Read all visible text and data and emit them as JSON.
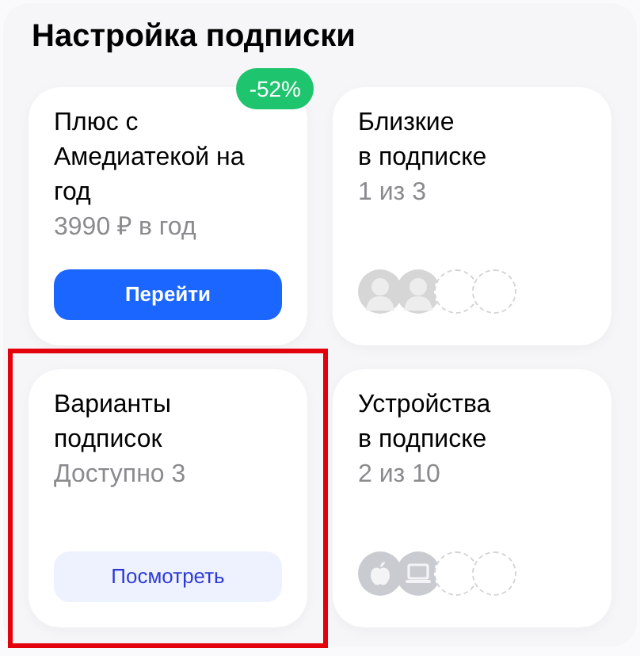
{
  "title": "Настройка подписки",
  "cards": [
    {
      "kind": "action",
      "title_lines": [
        "Плюс с",
        "Амедиатекой на",
        "год"
      ],
      "subtitle": "3990 ₽ в год",
      "badge": "-52%",
      "button": {
        "label": "Перейти",
        "kind": "primary"
      },
      "highlighted": false
    },
    {
      "kind": "slots",
      "title_lines": [
        "Близкие",
        "в подписке"
      ],
      "subtitle": "1 из 3",
      "slots": [
        {
          "kind": "person"
        },
        {
          "kind": "person"
        },
        {
          "kind": "empty"
        },
        {
          "kind": "empty"
        }
      ],
      "highlighted": false
    },
    {
      "kind": "action",
      "title_lines": [
        "Варианты",
        "подписок"
      ],
      "subtitle": "Доступно 3",
      "button": {
        "label": "Посмотреть",
        "kind": "secondary"
      },
      "highlighted": true
    },
    {
      "kind": "slots",
      "title_lines": [
        "Устройства",
        "в подписке"
      ],
      "subtitle": "2 из 10",
      "slots": [
        {
          "kind": "apple"
        },
        {
          "kind": "laptop"
        },
        {
          "kind": "empty"
        },
        {
          "kind": "empty"
        }
      ],
      "highlighted": false
    }
  ]
}
